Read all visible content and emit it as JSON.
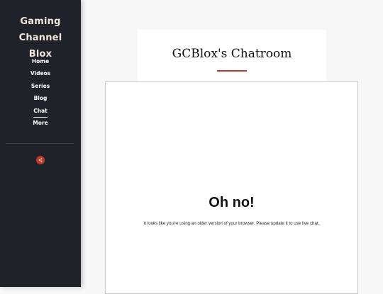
{
  "sidebar": {
    "site_title_line1": "Gaming Channel",
    "site_title_line2": "Blox",
    "nav": [
      {
        "label": "Home"
      },
      {
        "label": "Videos"
      },
      {
        "label": "Series"
      },
      {
        "label": "Blog"
      },
      {
        "label": "Chat",
        "active": true
      },
      {
        "label": "More"
      }
    ],
    "share_icon": "share-icon",
    "accent_color": "#c0392b"
  },
  "page": {
    "title": "GCBlox's Chatroom"
  },
  "chat": {
    "error_heading": "Oh no!",
    "error_message": "It looks like you're using an older version of your browser. Please update it to use live chat."
  }
}
